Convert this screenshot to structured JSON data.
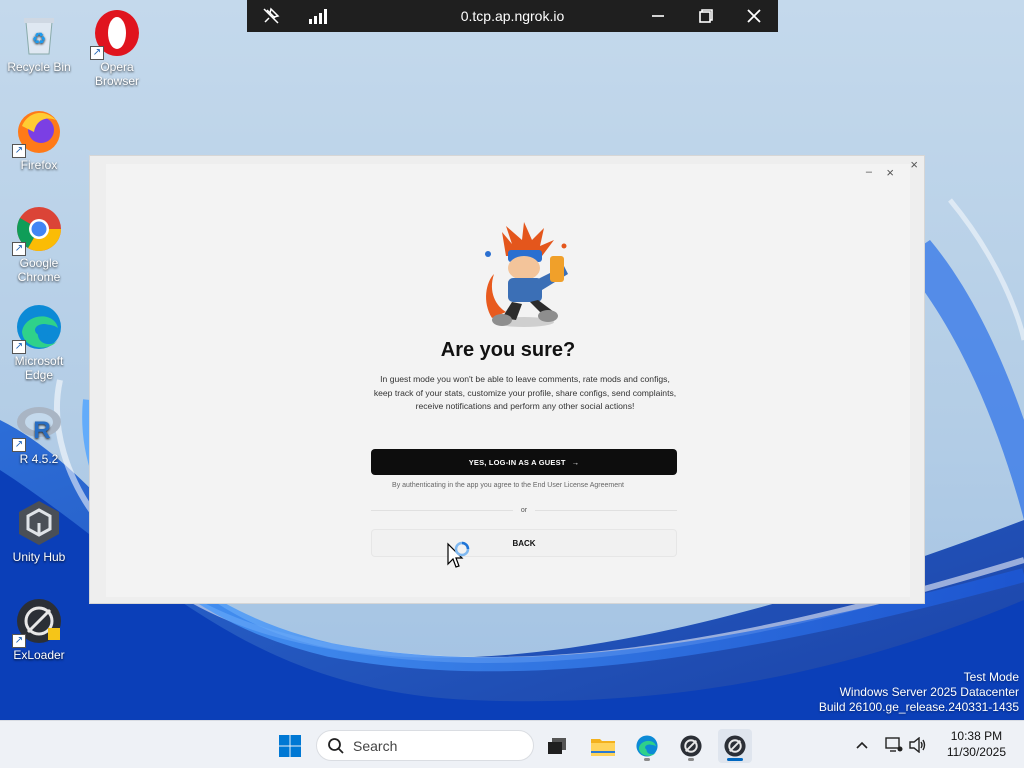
{
  "remote_bar": {
    "title": "0.tcp.ap.ngrok.io"
  },
  "desktop_icons": [
    {
      "label": "Recycle Bin"
    },
    {
      "label": "Opera Browser"
    },
    {
      "label": "Firefox"
    },
    {
      "label": "Google Chrome"
    },
    {
      "label": "Microsoft Edge"
    },
    {
      "label": "R 4.5.2"
    },
    {
      "label": "Unity Hub"
    },
    {
      "label": "ExLoader"
    }
  ],
  "dialog": {
    "title": "Are you sure?",
    "description": "In guest mode you won't be able to leave comments, rate mods and configs, keep track of your stats, customize your profile, share configs, send complaints, receive notifications and perform any other social actions!",
    "primary_button": "YES, LOG-IN AS A GUEST",
    "primary_button_arrow": "→",
    "terms_text": "By authenticating in the app you agree to the End User License Agreement",
    "or_text": "or",
    "back_button": "BACK",
    "minimize_glyph": "–",
    "close_glyph": "×"
  },
  "watermark": {
    "line1": "Test Mode",
    "line2": "Windows Server 2025 Datacenter",
    "line3": "Build 26100.ge_release.240331-1435"
  },
  "taskbar": {
    "search_placeholder": "Search",
    "time": "10:38 PM",
    "date": "11/30/2025"
  },
  "colors": {
    "accent": "#0067c0",
    "dialog_button": "#0d0d0d",
    "remote_bar": "#1f1f1f"
  }
}
